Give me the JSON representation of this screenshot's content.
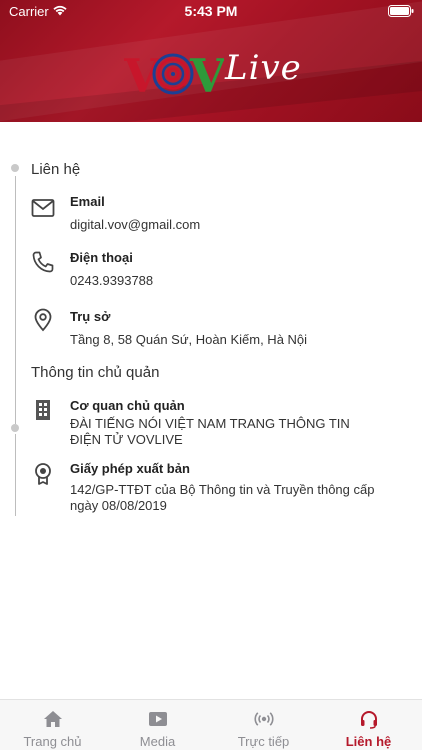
{
  "status_bar": {
    "carrier": "Carrier",
    "time": "5:43 PM"
  },
  "header": {
    "logo_text": "Live",
    "logo_letters": [
      "V",
      "V"
    ]
  },
  "contact": {
    "section_title": "Liên hệ",
    "email": {
      "label": "Email",
      "value": "digital.vov@gmail.com"
    },
    "phone": {
      "label": "Điện thoại",
      "value": "0243.9393788"
    },
    "office": {
      "label": "Trụ sở",
      "value": "Tầng 8, 58 Quán Sứ, Hoàn Kiếm, Hà Nội"
    }
  },
  "owner": {
    "section_title": "Thông tin chủ quản",
    "agency": {
      "label": "Cơ quan chủ quản",
      "value": "ĐÀI TIẾNG NÓI VIỆT NAM TRANG THÔNG TIN ĐIỆN TỬ VOVLIVE"
    },
    "license": {
      "label": "Giấy phép xuất bản",
      "value": "142/GP-TTĐT của Bộ Thông tin và Truyền thông cấp ngày 08/08/2019"
    }
  },
  "tabbar": {
    "tabs": [
      {
        "label": "Trang chủ",
        "icon": "home-icon",
        "active": false
      },
      {
        "label": "Media",
        "icon": "play-icon",
        "active": false
      },
      {
        "label": "Trực tiếp",
        "icon": "broadcast-icon",
        "active": false
      },
      {
        "label": "Liên hệ",
        "icon": "headset-icon",
        "active": true
      }
    ]
  },
  "colors": {
    "brand": "#b5192b",
    "inactive": "#8e8e93",
    "logo_green": "#2e9a3a",
    "logo_blue": "#1c3f94"
  }
}
